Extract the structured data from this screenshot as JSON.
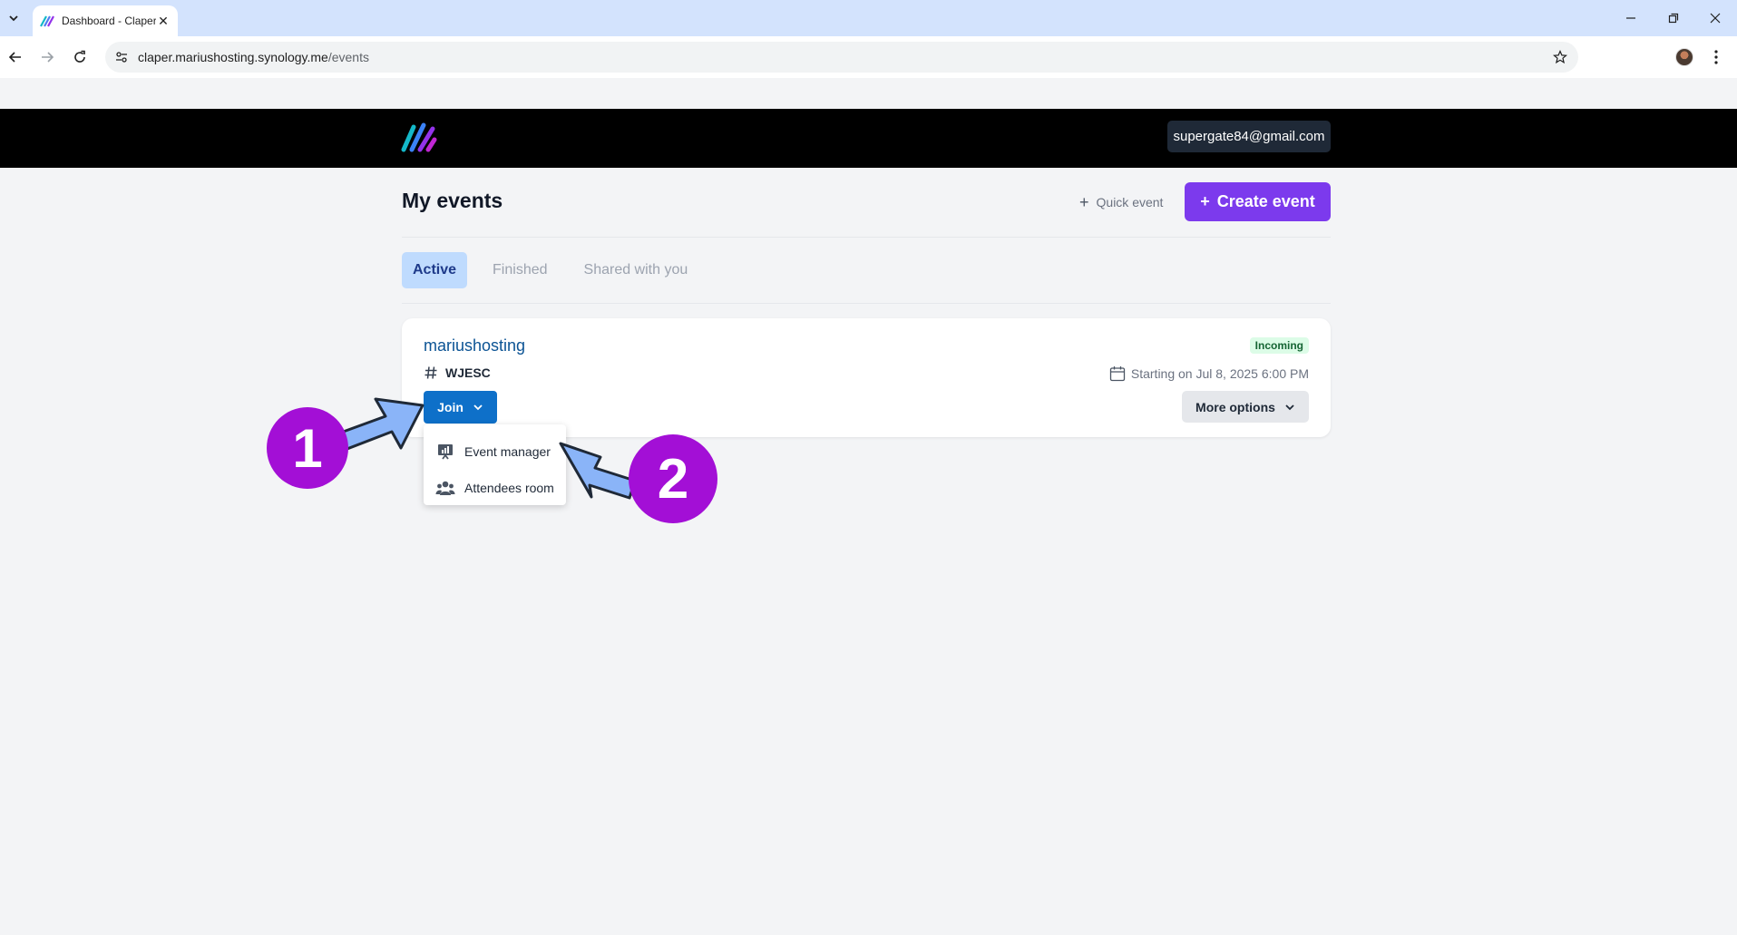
{
  "browser": {
    "tab_title": "Dashboard - Claper",
    "url_host": "claper.mariushosting.synology.me",
    "url_path": "/events",
    "icons": {
      "tab_menu": "chevron-down-icon",
      "close": "close-icon",
      "back": "arrow-left-icon",
      "forward": "arrow-right-icon",
      "reload": "reload-icon",
      "site_info": "tune-icon",
      "bookmark": "star-icon",
      "menu": "kebab-icon"
    }
  },
  "header": {
    "user_email": "supergate84@gmail.com",
    "colors": {
      "background": "#000000",
      "chip": "#1f2937"
    }
  },
  "page": {
    "title": "My events",
    "quick_event_label": "Quick event",
    "create_event_label": "Create event",
    "tabs": [
      {
        "label": "Active",
        "active": true
      },
      {
        "label": "Finished",
        "active": false
      },
      {
        "label": "Shared with you",
        "active": false
      }
    ]
  },
  "event": {
    "name": "mariushosting",
    "status": "Incoming",
    "code": "WJESC",
    "start": "Starting on Jul 8, 2025 6:00 PM",
    "join_label": "Join",
    "more_options_label": "More options"
  },
  "join_menu": {
    "items": [
      {
        "label": "Event manager",
        "icon": "presentation-chart-icon"
      },
      {
        "label": "Attendees room",
        "icon": "users-icon"
      }
    ]
  },
  "annotations": {
    "step1": "1",
    "step2": "2",
    "color": "#a30fd6",
    "arrow_color": "#8ab4f8"
  },
  "colors": {
    "accent": "#7c3aed",
    "join": "#0e70c9",
    "badge_bg": "#dcfce7",
    "badge_text": "#166534",
    "active_tab_bg": "#bfdbfe"
  }
}
